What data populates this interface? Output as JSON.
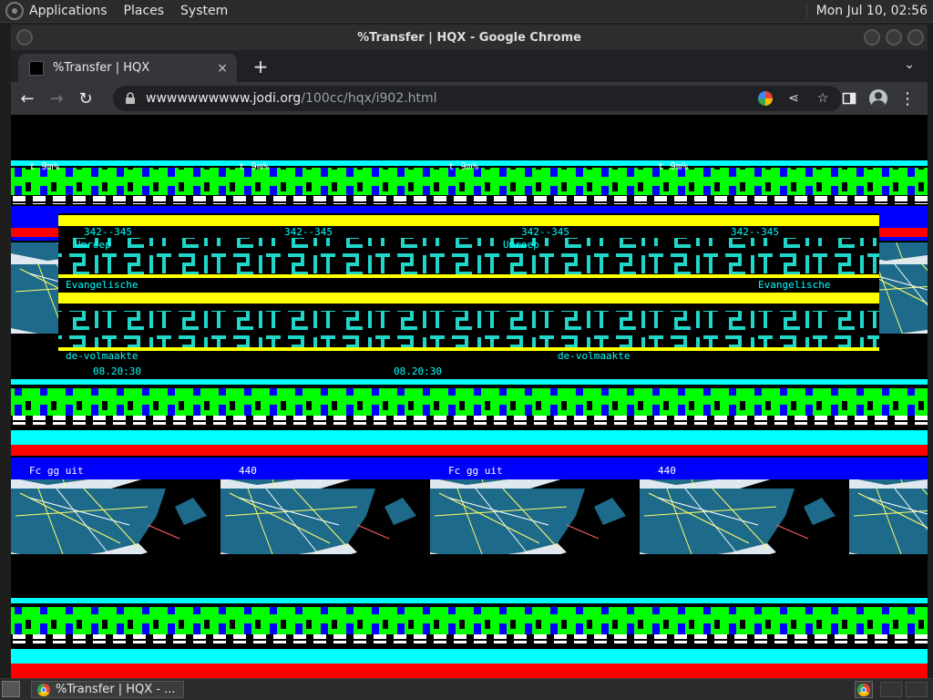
{
  "top_panel": {
    "menus": [
      "Applications",
      "Places",
      "System"
    ],
    "clock": "Mon Jul 10, 02:56"
  },
  "window": {
    "title": "%Transfer | HQX - Google Chrome"
  },
  "tab": {
    "title": "%Transfer | HQX",
    "close": "×",
    "new_tab": "+",
    "dropdown": "⌄"
  },
  "toolbar": {
    "back": "←",
    "forward": "→",
    "reload": "↻",
    "url_host": "wwwwwwwwww.jodi.org",
    "url_path": "/100cc/hqx/i902.html",
    "share": "⋖",
    "star": "☆",
    "more": "⋮"
  },
  "taskbar": {
    "item_title": "%Transfer | HQX - ..."
  },
  "content": {
    "texts": [
      "342--345",
      "Umroep",
      "Evangelische",
      "08.20:30",
      "Sage",
      "t 9m%",
      "440",
      "Fc gg uit",
      "de-volmaakte"
    ]
  },
  "colors": {
    "cyan": "#00ffff",
    "lime": "#00ff00",
    "blue": "#0000ff",
    "yellow": "#ffff00",
    "red": "#ff0000",
    "teal": "#1e6a8a"
  }
}
